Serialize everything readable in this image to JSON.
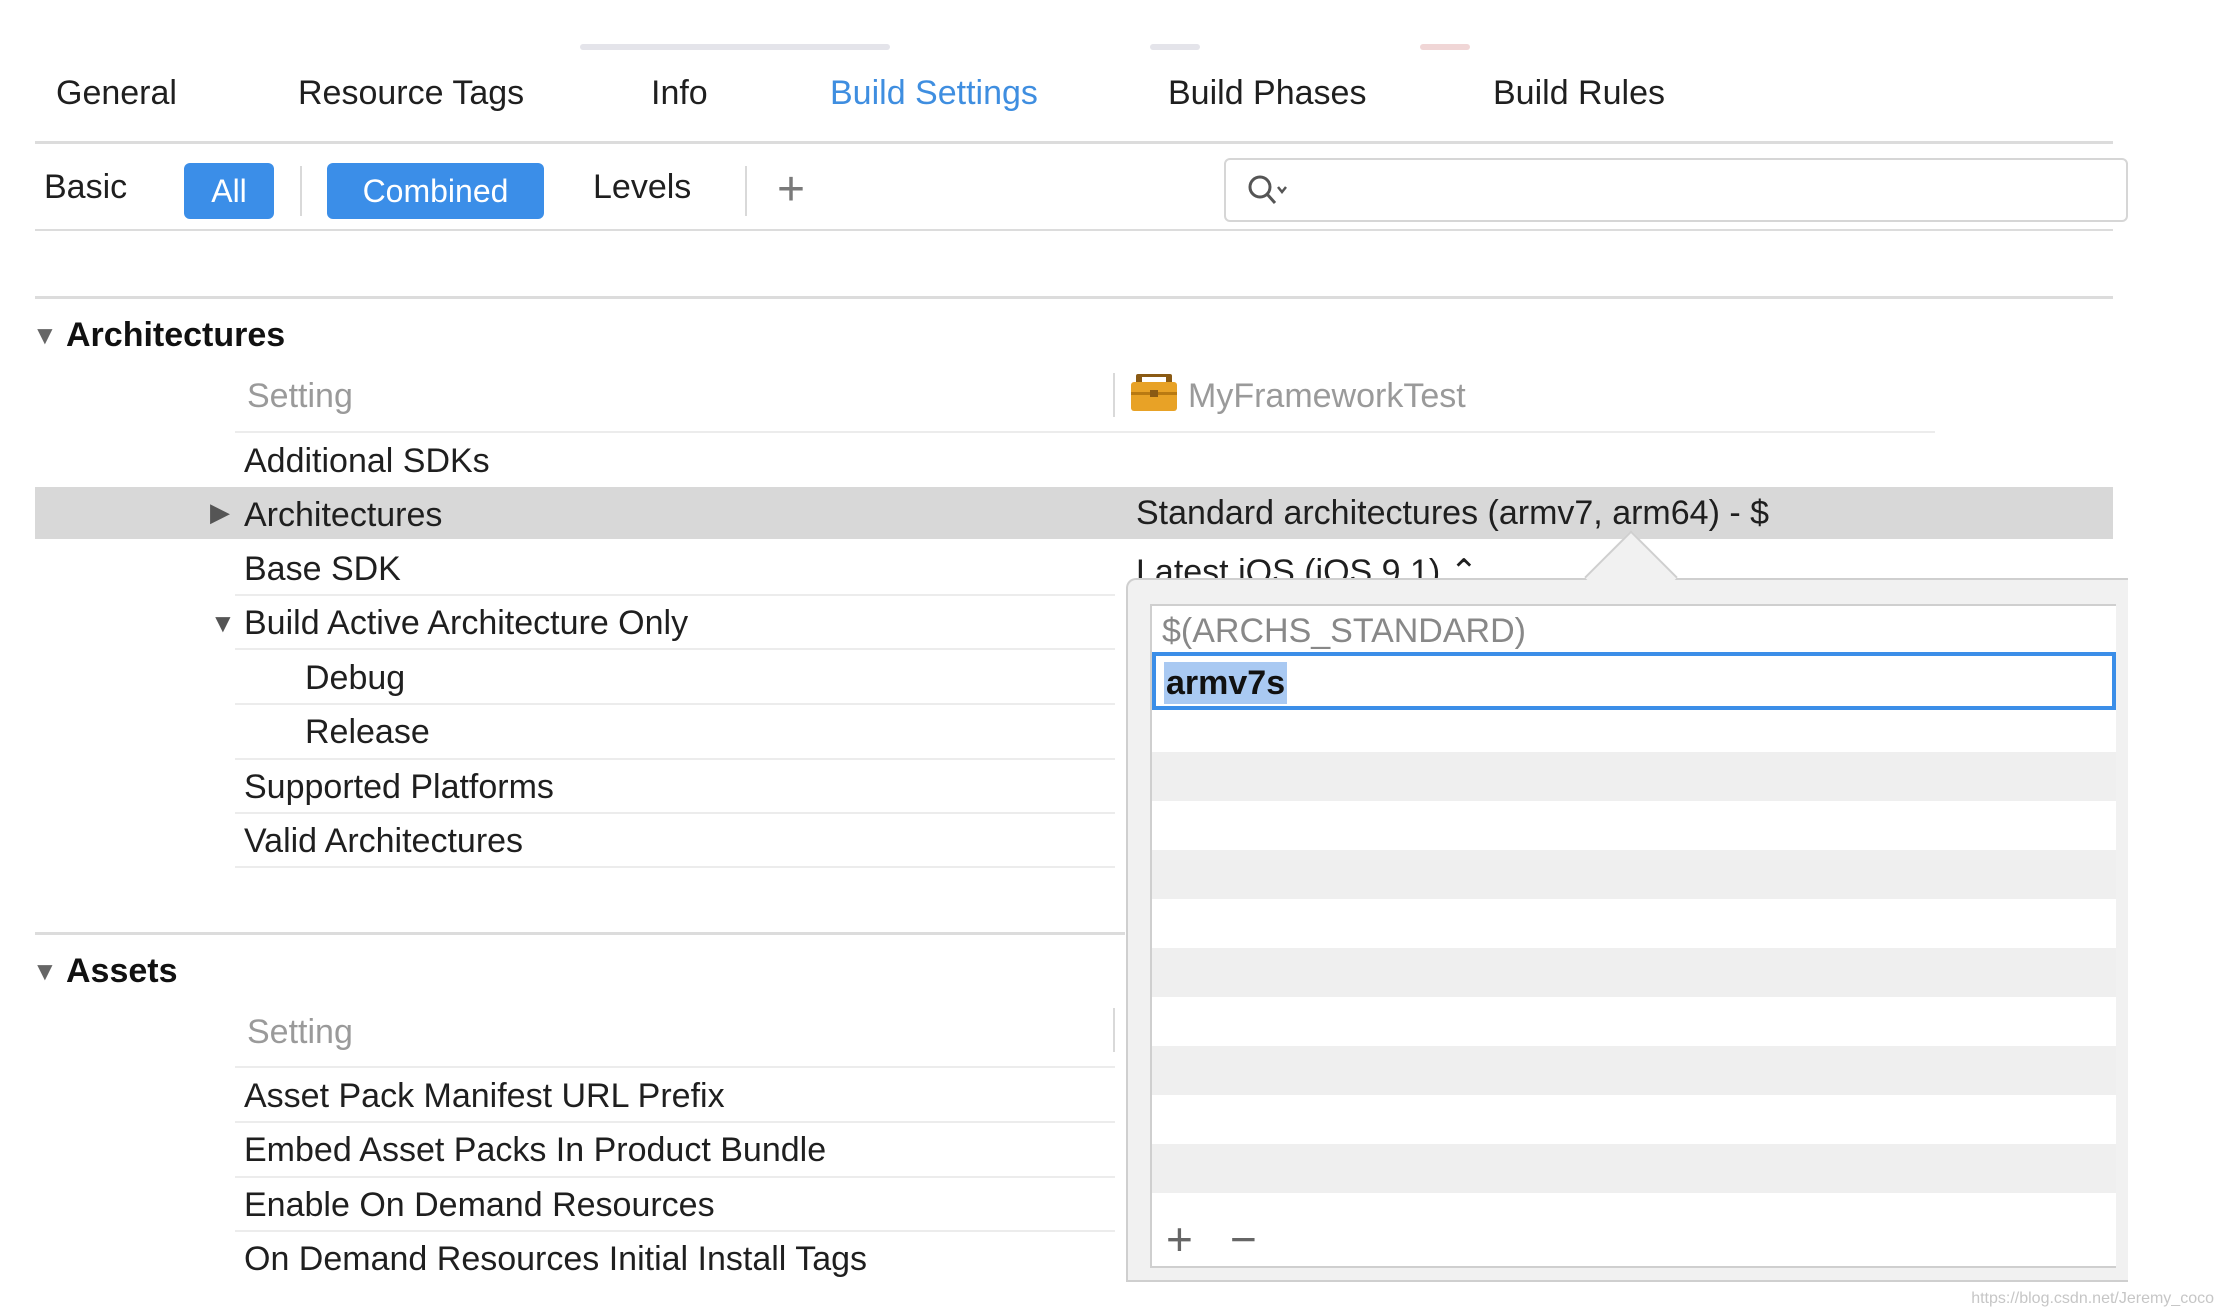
{
  "tabs": [
    {
      "label": "General",
      "active": false
    },
    {
      "label": "Resource Tags",
      "active": false
    },
    {
      "label": "Info",
      "active": false
    },
    {
      "label": "Build Settings",
      "active": true
    },
    {
      "label": "Build Phases",
      "active": false
    },
    {
      "label": "Build Rules",
      "active": false
    }
  ],
  "filters": {
    "basic": "Basic",
    "all": "All",
    "combined": "Combined",
    "levels": "Levels",
    "add": "+"
  },
  "search": {
    "placeholder": ""
  },
  "colors": {
    "accent": "#3b8ee8",
    "selection": "#d8d8d8"
  },
  "architectures": {
    "title": "Architectures",
    "setting_header": "Setting",
    "target_header": "MyFrameworkTest",
    "rows": [
      {
        "label": "Additional SDKs",
        "value": ""
      },
      {
        "label": "Architectures",
        "value": "Standard architectures (armv7, arm64)  -  $"
      },
      {
        "label": "Base SDK",
        "value": "Latest iOS (iOS 9.1) ⌃"
      },
      {
        "label": "Build Active Architecture Only",
        "value": ""
      },
      {
        "label": "Debug",
        "value": ""
      },
      {
        "label": "Release",
        "value": ""
      },
      {
        "label": "Supported Platforms",
        "value": ""
      },
      {
        "label": "Valid Architectures",
        "value": ""
      }
    ]
  },
  "assets": {
    "title": "Assets",
    "setting_header": "Setting",
    "rows": [
      {
        "label": "Asset Pack Manifest URL Prefix"
      },
      {
        "label": "Embed Asset Packs In Product Bundle"
      },
      {
        "label": "Enable On Demand Resources"
      },
      {
        "label": "On Demand Resources Initial Install Tags"
      }
    ]
  },
  "popover": {
    "items": [
      "$(ARCHS_STANDARD)",
      "armv7s"
    ],
    "add": "+",
    "remove": "−"
  },
  "watermark": "https://blog.csdn.net/Jeremy_coco"
}
